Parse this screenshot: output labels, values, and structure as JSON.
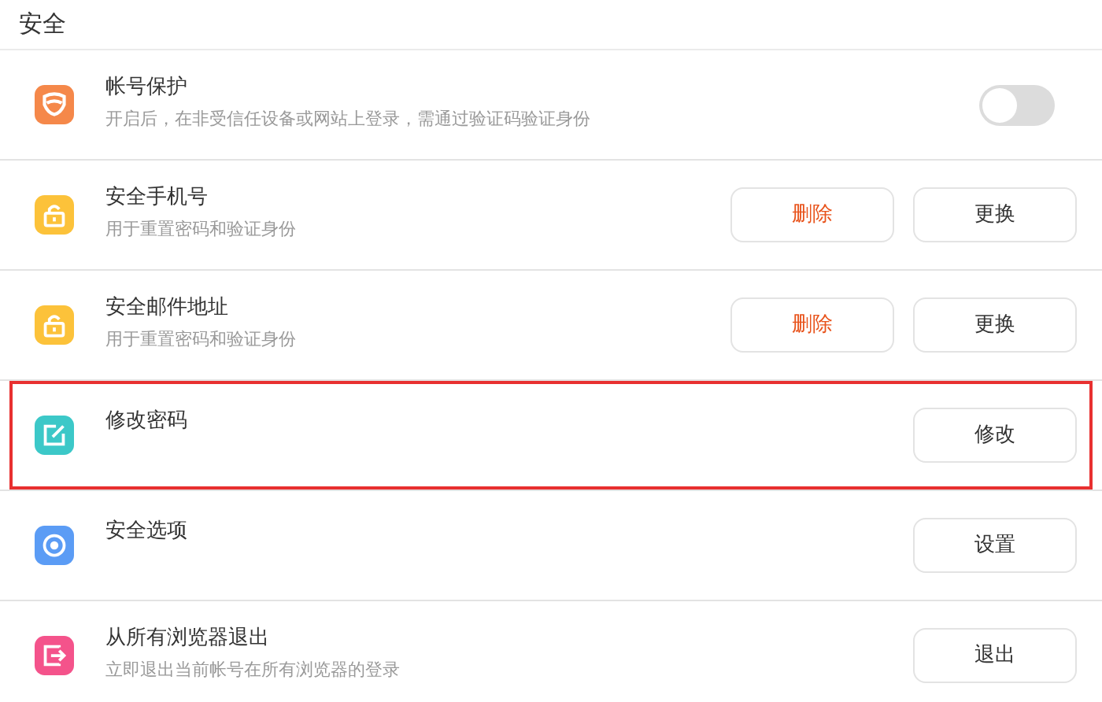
{
  "section_title": "安全",
  "items": [
    {
      "kind": "shield",
      "color": "#f5884a",
      "title": "帐号保护",
      "description": "开启后，在非受信任设备或网站上登录，需通过验证码验证身份",
      "highlighted": false,
      "toggle": {
        "on": false
      }
    },
    {
      "kind": "lock",
      "color": "#fcc23a",
      "title": "安全手机号",
      "description": "用于重置密码和验证身份",
      "highlighted": false,
      "buttons": [
        {
          "label": "删除",
          "kind": "danger"
        },
        {
          "label": "更换",
          "kind": "normal"
        }
      ]
    },
    {
      "kind": "lock",
      "color": "#fcc23a",
      "title": "安全邮件地址",
      "description": "用于重置密码和验证身份",
      "highlighted": false,
      "buttons": [
        {
          "label": "删除",
          "kind": "danger"
        },
        {
          "label": "更换",
          "kind": "normal"
        }
      ]
    },
    {
      "kind": "edit",
      "color": "#3cc8c8",
      "title": "修改密码",
      "highlighted": true,
      "buttons": [
        {
          "label": "修改",
          "kind": "normal"
        }
      ]
    },
    {
      "kind": "target",
      "color": "#5b9cf5",
      "title": "安全选项",
      "highlighted": false,
      "buttons": [
        {
          "label": "设置",
          "kind": "normal"
        }
      ]
    },
    {
      "kind": "exit",
      "color": "#f4538b",
      "title": "从所有浏览器退出",
      "description": "立即退出当前帐号在所有浏览器的登录",
      "highlighted": false,
      "buttons": [
        {
          "label": "退出",
          "kind": "normal"
        }
      ]
    }
  ]
}
